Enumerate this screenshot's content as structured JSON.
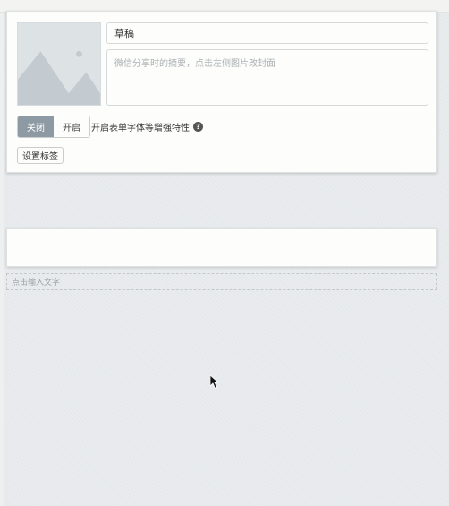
{
  "article": {
    "title_value": "草稿",
    "summary_placeholder": "微信分享时的摘要，点击左侧图片改封面",
    "cover_image_alt": "mountain-image-placeholder"
  },
  "enhance_toggle": {
    "off_label": "关闭",
    "on_label": "开启",
    "selected": "关闭",
    "description": "开启表单字体等增强特性",
    "help_icon": "question-circle-icon"
  },
  "tags": {
    "button_label": "设置标签"
  },
  "editor": {
    "text_placeholder": "点击输入文字"
  },
  "colors": {
    "toggle_active": "#8e9aa3",
    "background": "#e9ecee"
  }
}
